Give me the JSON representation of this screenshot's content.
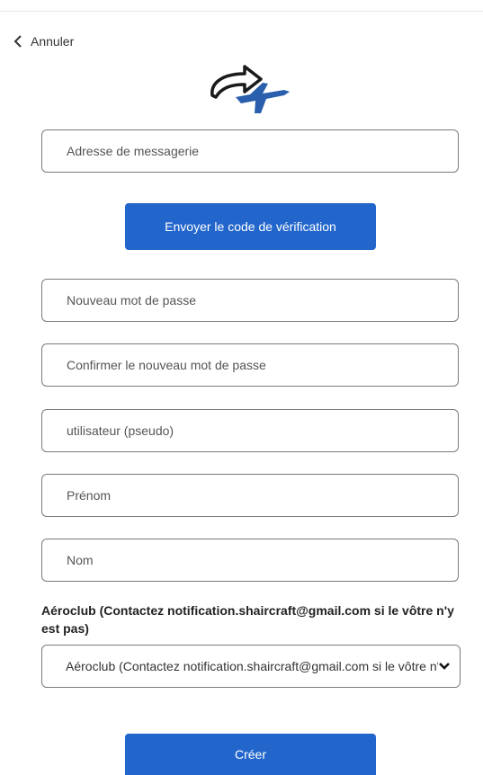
{
  "header": {
    "back_label": "Annuler"
  },
  "form": {
    "email_placeholder": "Adresse de messagerie",
    "send_code_label": "Envoyer le code de vérification",
    "new_password_placeholder": "Nouveau mot de passe",
    "confirm_password_placeholder": "Confirmer le nouveau mot de passe",
    "username_placeholder": "utilisateur (pseudo)",
    "firstname_placeholder": "Prénom",
    "lastname_placeholder": "Nom",
    "club_label": "Aéroclub (Contactez notification.shaircraft@gmail.com si le vôtre n'y est pas)",
    "club_selected": "Aéroclub (Contactez notification.shaircraft@gmail.com si le vôtre n'y est pas)",
    "create_label": "Créer"
  },
  "colors": {
    "primary": "#2266cc",
    "logo_plane": "#2a5fae",
    "logo_arrow": "#1a1a1a"
  },
  "icons": {
    "back": "chevron-left-icon",
    "logo": "plane-share-icon",
    "select": "chevron-down-icon"
  }
}
